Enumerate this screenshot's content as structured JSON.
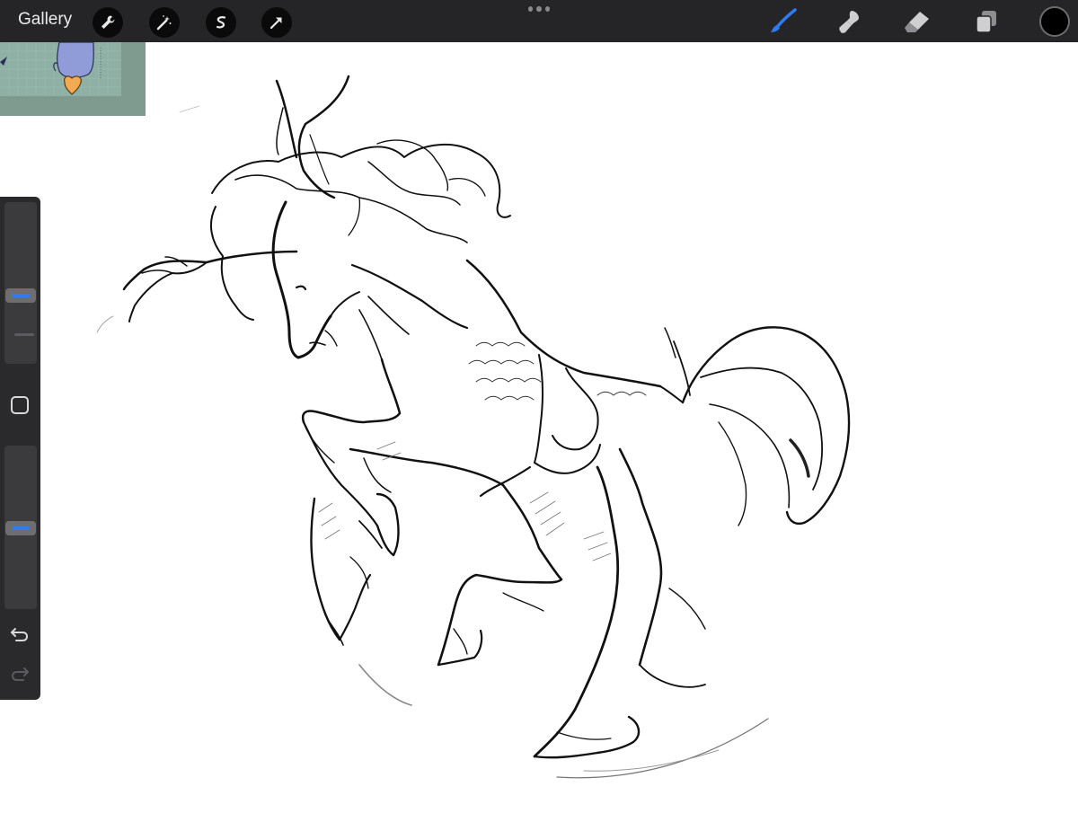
{
  "toolbar": {
    "gallery_label": "Gallery",
    "left_tools": [
      "wrench-icon",
      "magic-wand-icon",
      "selection-icon",
      "transform-icon"
    ],
    "right_tools": [
      "brush-icon",
      "smudge-icon",
      "eraser-icon",
      "layers-icon"
    ],
    "active_tool": "brush-icon",
    "active_color": "#2f7bf0",
    "current_color": "#000000"
  },
  "sidebar": {
    "brush_size": 0.45,
    "opacity": 0.5,
    "buttons": [
      "modify-button",
      "undo-button",
      "redo-button"
    ]
  },
  "reference": {
    "background": "#7f9b90"
  },
  "canvas": {
    "background": "#ffffff",
    "subject": "sketch"
  }
}
